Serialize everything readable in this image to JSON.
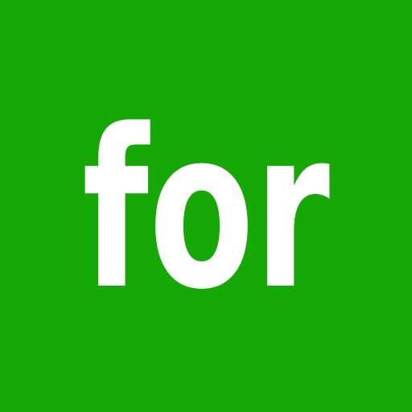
{
  "tile": {
    "word": "for",
    "background_color": "#16a805",
    "text_color": "#ffffff"
  }
}
